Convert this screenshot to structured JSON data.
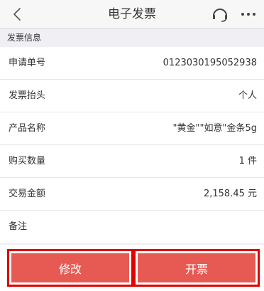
{
  "header": {
    "title": "电子发票",
    "back_icon": "chevron-left-icon",
    "service_icon": "headset-icon",
    "more_icon": "more-dots-icon"
  },
  "section": {
    "title": "发票信息"
  },
  "rows": [
    {
      "label": "申请单号",
      "value": "0123030195052938"
    },
    {
      "label": "发票抬头",
      "value": "个人"
    },
    {
      "label": "产品名称",
      "value": "\"黄金\"\"如意\"金条5g"
    },
    {
      "label": "购买数量",
      "value": "1 件"
    },
    {
      "label": "交易金额",
      "value": "2,158.45 元"
    },
    {
      "label": "备注",
      "value": ""
    }
  ],
  "actions": {
    "modify_label": "修改",
    "issue_label": "开票"
  },
  "colors": {
    "button_fill": "#e65a53",
    "button_outline": "#e00000",
    "page_bg": "#efeff4"
  }
}
